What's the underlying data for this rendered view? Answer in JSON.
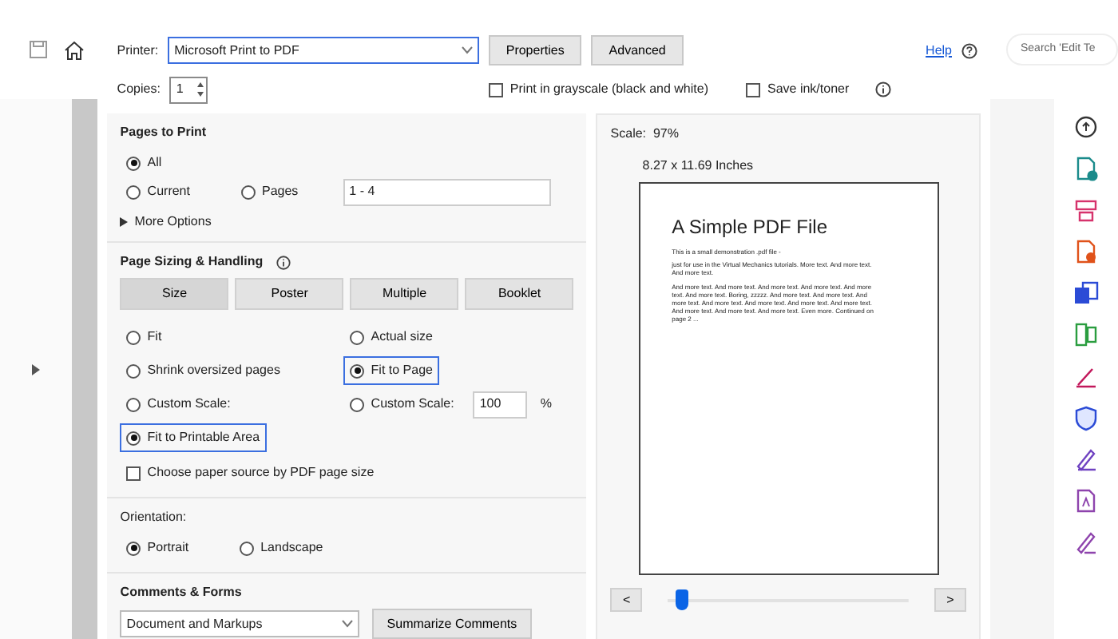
{
  "search": {
    "placeholder": "Search 'Edit Te"
  },
  "dialog": {
    "printer": {
      "label": "Printer:",
      "value": "Microsoft Print to PDF"
    },
    "buttons": [
      "Properties",
      "Advanced"
    ],
    "help": "Help",
    "copies": {
      "label": "Copies:",
      "value": "1"
    },
    "print_options": [
      {
        "label": "Print in grayscale (black and white)",
        "checked": false
      },
      {
        "label": "Save ink/toner",
        "checked": false
      }
    ],
    "pages_to_print": {
      "title": "Pages to Print",
      "options": [
        {
          "label": "All",
          "selected": true
        },
        {
          "label": "Current",
          "selected": false
        },
        {
          "label": "Pages",
          "selected": false
        }
      ],
      "pages_value": "1 - 4",
      "more_options": "More Options"
    },
    "page_sizing": {
      "title": "Page Sizing & Handling",
      "tabs": [
        {
          "label": "Size",
          "selected": true
        },
        {
          "label": "Poster",
          "selected": false
        },
        {
          "label": "Multiple",
          "selected": false
        },
        {
          "label": "Booklet",
          "selected": false
        }
      ],
      "options_left": [
        {
          "label": "Fit",
          "selected": false
        },
        {
          "label": "Shrink oversized pages",
          "selected": false
        },
        {
          "label": "Custom Scale:",
          "selected": false
        },
        {
          "label": "Fit to Printable Area",
          "selected": true
        }
      ],
      "options_right": [
        {
          "label": "Actual size",
          "selected": false
        },
        {
          "label": "Fit to Page",
          "selected": true
        },
        {
          "label": "Custom Scale:",
          "selected": false,
          "value": "100",
          "unit": "%"
        }
      ],
      "paper_source": {
        "label": "Choose paper source by PDF page size",
        "checked": false
      }
    },
    "orientation": {
      "title": "Orientation:",
      "options": [
        {
          "label": "Portrait",
          "selected": true
        },
        {
          "label": "Landscape",
          "selected": false
        }
      ]
    },
    "comments": {
      "title": "Comments & Forms",
      "value": "Document and Markups",
      "button": "Summarize Comments"
    },
    "preview": {
      "scale": "Scale:  97%",
      "size": "8.27 x 11.69 Inches",
      "document": {
        "title": "A Simple PDF File",
        "paragraphs": [
          "This is a small demonstration .pdf file -",
          "just for use in the Virtual Mechanics tutorials. More text. And more text. And more text.",
          "And more text. And more text. And more text. And more text. And more text. And more text. Boring, zzzzz. And more text. And more text. And more text. And more text. And more text. And more text. And more text. And more text. And more text. And more text. Even more. Continued on page 2 ..."
        ]
      },
      "slider": {
        "level": 0.03
      },
      "prev": "<",
      "next": ">"
    }
  }
}
